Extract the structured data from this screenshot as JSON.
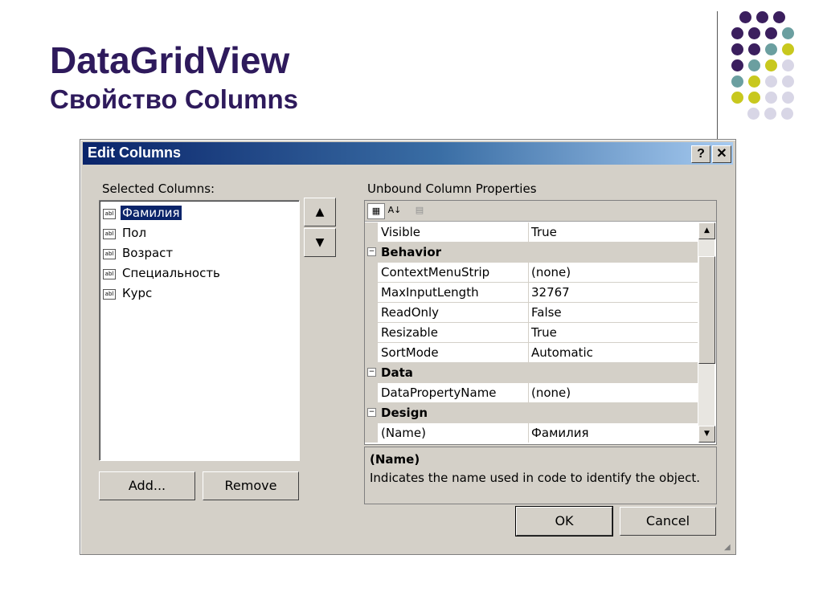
{
  "slide": {
    "title": "DataGridView",
    "subtitle": "Свойство Columns"
  },
  "decor": {
    "colors": {
      "purple": "#3b1f5e",
      "teal": "#6b9fa0",
      "yellow": "#c8c81e",
      "lavender": "#d8d6e6"
    }
  },
  "dialog": {
    "title": "Edit Columns",
    "help_label": "?",
    "close_label": "✕",
    "selected_columns_label": "Selected Columns:",
    "columns": [
      "Фамилия",
      "Пол",
      "Возраст",
      "Специальность",
      "Курс"
    ],
    "column_icon": "abl",
    "selected_index": 0,
    "move_up_label": "▲",
    "move_down_label": "▼",
    "add_label": "Add...",
    "remove_label": "Remove",
    "properties_label": "Unbound Column Properties",
    "toolbar": {
      "categorized_icon": "categorized-icon",
      "alphabetical_icon": "sort-az-icon",
      "pages_icon": "property-pages-icon"
    },
    "properties": [
      {
        "name": "Visible",
        "value": "True",
        "category": false
      },
      {
        "name": "Behavior",
        "value": "",
        "category": true
      },
      {
        "name": "ContextMenuStrip",
        "value": "(none)",
        "category": false
      },
      {
        "name": "MaxInputLength",
        "value": "32767",
        "category": false
      },
      {
        "name": "ReadOnly",
        "value": "False",
        "category": false
      },
      {
        "name": "Resizable",
        "value": "True",
        "category": false
      },
      {
        "name": "SortMode",
        "value": "Automatic",
        "category": false
      },
      {
        "name": "Data",
        "value": "",
        "category": true
      },
      {
        "name": "DataPropertyName",
        "value": "(none)",
        "category": false
      },
      {
        "name": "Design",
        "value": "",
        "category": true
      },
      {
        "name": "(Name)",
        "value": "Фамилия",
        "category": false
      }
    ],
    "description_title": "(Name)",
    "description_text": "Indicates the name used in code to identify the object.",
    "ok_label": "OK",
    "cancel_label": "Cancel",
    "category_toggle": "⊟"
  }
}
